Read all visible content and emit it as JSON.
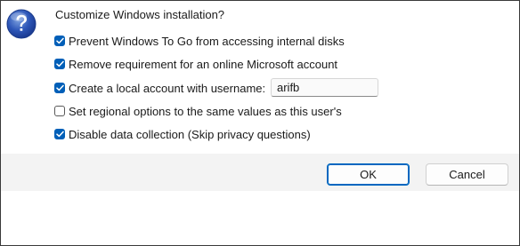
{
  "dialog": {
    "title": "Customize Windows installation?",
    "icon": "question-icon",
    "accent_color": "#005fb8"
  },
  "options": [
    {
      "label": "Prevent Windows To Go from accessing internal disks",
      "checked": true
    },
    {
      "label": "Remove requirement for an online Microsoft account",
      "checked": true
    },
    {
      "label": "Create a local account with username:",
      "checked": true
    },
    {
      "label": "Set regional options to the same values as this user's",
      "checked": false
    },
    {
      "label": "Disable data collection (Skip privacy questions)",
      "checked": true
    }
  ],
  "username": {
    "value": "arifb"
  },
  "buttons": {
    "ok": "OK",
    "cancel": "Cancel"
  }
}
